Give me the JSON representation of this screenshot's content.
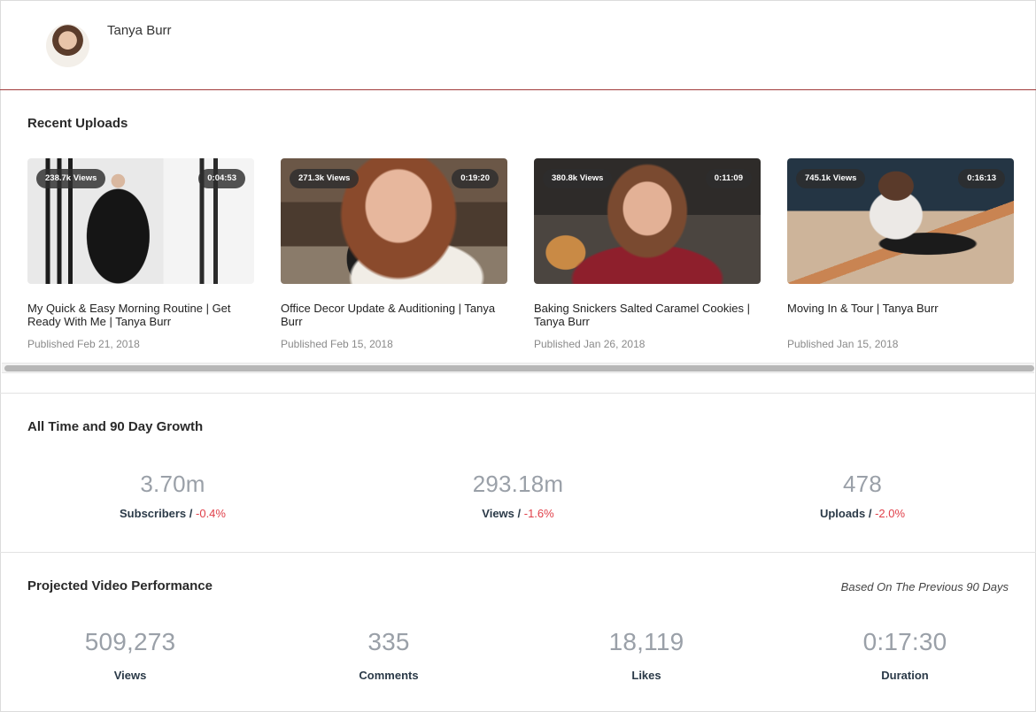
{
  "channel": {
    "name": "Tanya Burr"
  },
  "recent_uploads": {
    "title": "Recent Uploads",
    "videos": [
      {
        "views": "238.7k Views",
        "duration": "0:04:53",
        "title": "My Quick & Easy Morning Routine | Get Ready With Me | Tanya Burr",
        "published": "Published Feb 21, 2018"
      },
      {
        "views": "271.3k Views",
        "duration": "0:19:20",
        "title": "Office Decor Update & Auditioning | Tanya Burr",
        "published": "Published Feb 15, 2018"
      },
      {
        "views": "380.8k Views",
        "duration": "0:11:09",
        "title": "Baking Snickers Salted Caramel Cookies | Tanya Burr",
        "published": "Published Jan 26, 2018"
      },
      {
        "views": "745.1k Views",
        "duration": "0:16:13",
        "title": "Moving In & Tour | Tanya Burr",
        "published": "Published Jan 15, 2018"
      }
    ]
  },
  "growth": {
    "title": "All Time and 90 Day Growth",
    "stats": [
      {
        "value": "3.70m",
        "label": "Subscribers",
        "sep": " / ",
        "change": "-0.4%"
      },
      {
        "value": "293.18m",
        "label": "Views",
        "sep": " / ",
        "change": "-1.6%"
      },
      {
        "value": "478",
        "label": "Uploads",
        "sep": " / ",
        "change": "-2.0%"
      }
    ]
  },
  "projected": {
    "title": "Projected Video Performance",
    "note": "Based On The Previous 90 Days",
    "stats": [
      {
        "value": "509,273",
        "label": "Views"
      },
      {
        "value": "335",
        "label": "Comments"
      },
      {
        "value": "18,119",
        "label": "Likes"
      },
      {
        "value": "0:17:30",
        "label": "Duration"
      }
    ]
  },
  "colors": {
    "accent_line": "#a13b3b",
    "negative": "#e0404a",
    "stat_value": "#9aa0a8",
    "stat_label": "#2b3a48"
  }
}
